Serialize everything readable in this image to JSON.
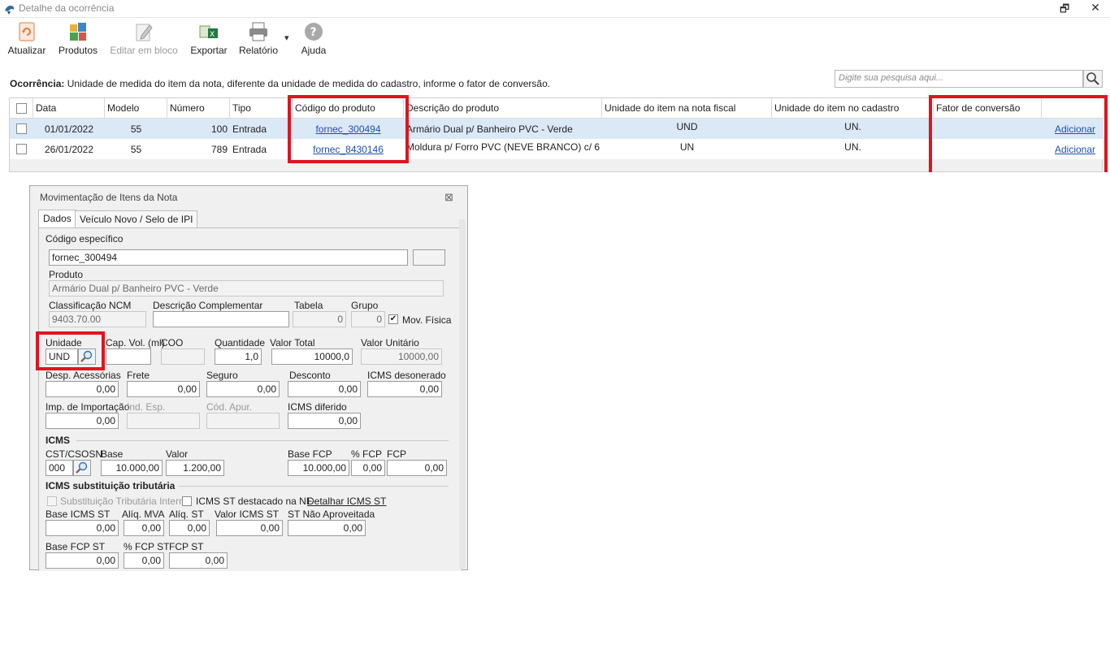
{
  "window": {
    "title": "Detalhe da ocorrência",
    "restore_glyph": "🗗",
    "close_glyph": "✕"
  },
  "toolbar": {
    "atualizar": "Atualizar",
    "produtos": "Produtos",
    "editar_em_bloco": "Editar em bloco",
    "exportar": "Exportar",
    "relatorio": "Relatório",
    "relatorio_arrow": "▾",
    "ajuda": "Ajuda"
  },
  "ocorrencia": {
    "label": "Ocorrência:",
    "text": "Unidade de medida do item da nota, diferente da unidade de medida do cadastro, informe o fator de conversão."
  },
  "search": {
    "placeholder": "Digite sua pesquisa aqui..."
  },
  "grid": {
    "columns": {
      "data": "Data",
      "modelo": "Modelo",
      "numero": "Número",
      "tipo": "Tipo",
      "codigo_produto": "Código do produto",
      "descricao_produto": "Descrição do produto",
      "unidade_nota": "Unidade do item na nota fiscal",
      "unidade_cadastro": "Unidade do item no cadastro",
      "fator_conversao": "Fator de conversão"
    },
    "rows": [
      {
        "data": "01/01/2022",
        "modelo": "55",
        "numero": "100",
        "tipo": "Entrada",
        "codigo_produto": "fornec_300494",
        "descricao_produto": "Armário Dual p/ Banheiro PVC - Verde",
        "unidade_nota": "UND",
        "unidade_cadastro": "UN.",
        "fator_conversao": "",
        "acao": "Adicionar"
      },
      {
        "data": "26/01/2022",
        "modelo": "55",
        "numero": "789",
        "tipo": "Entrada",
        "codigo_produto": "fornec_8430146",
        "descricao_produto": "Moldura p/ Forro PVC (NEVE BRANCO) c/ 6",
        "unidade_nota": "UN",
        "unidade_cadastro": "UN.",
        "fator_conversao": "",
        "acao": "Adicionar"
      }
    ]
  },
  "dialog": {
    "title": "Movimentação de Itens da Nota",
    "close_glyph": "⊠",
    "tabs": [
      "Dados",
      "Veículo Novo / Selo de IPI"
    ],
    "codigo_especifico_label": "Código específico",
    "codigo_especifico_value": "fornec_300494",
    "produto_label": "Produto",
    "produto_value": "Armário Dual p/ Banheiro PVC - Verde",
    "classificacao_ncm_label": "Classificação NCM",
    "classificacao_ncm_value": "9403.70.00",
    "descricao_complementar_label": "Descrição Complementar",
    "descricao_complementar_value": "",
    "tabela_label": "Tabela",
    "tabela_value": "0",
    "grupo_label": "Grupo",
    "grupo_value": "0",
    "mov_fisica_label": "Mov. Física",
    "mov_fisica_mark": "✔",
    "unidade_label": "Unidade",
    "unidade_value": "UND",
    "cap_vol_label": "Cap. Vol. (ml)",
    "cap_vol_value": "",
    "coo_label": "COO",
    "coo_value": "",
    "quantidade_label": "Quantidade",
    "quantidade_value": "1,0",
    "valor_total_label": "Valor Total",
    "valor_total_value": "10000,0",
    "valor_unitario_label": "Valor Unitário",
    "valor_unitario_value": "10000,00",
    "desp_acessorias_label": "Desp. Acessórias",
    "desp_acessorias_value": "0,00",
    "frete_label": "Frete",
    "frete_value": "0,00",
    "seguro_label": "Seguro",
    "seguro_value": "0,00",
    "desconto_label": "Desconto",
    "desconto_value": "0,00",
    "icms_desonerado_label": "ICMS desonerado",
    "icms_desonerado_value": "0,00",
    "imp_importacao_label": "Imp. de Importação",
    "imp_importacao_value": "0,00",
    "ind_esp_label": "Ind. Esp.",
    "cod_apur_label": "Cód. Apur.",
    "icms_diferido_label": "ICMS diferido",
    "icms_diferido_value": "0,00",
    "icms_section": "ICMS",
    "cst_csosn_label": "CST/CSOSN",
    "cst_csosn_value": "000",
    "base_label": "Base",
    "base_value": "10.000,00",
    "valor_label": "Valor",
    "valor_value": "1.200,00",
    "base_fcp_label": "Base FCP",
    "base_fcp_value": "10.000,00",
    "pct_fcp_label": "% FCP",
    "pct_fcp_value": "0,00",
    "fcp_label": "FCP",
    "fcp_value": "0,00",
    "icms_st_section": "ICMS substituição tributária",
    "st_interna_label": "Substituição Tributária Interna",
    "icms_st_destacado_label": "ICMS ST destacado na NF",
    "detalhar_icms_st": "Detalhar ICMS ST",
    "base_icms_st_label": "Base ICMS ST",
    "base_icms_st_value": "0,00",
    "aliq_mva_label": "Alíq. MVA",
    "aliq_mva_value": "0,00",
    "aliq_st_label": "Alíq. ST",
    "aliq_st_value": "0,00",
    "valor_icms_st_label": "Valor ICMS ST",
    "valor_icms_st_value": "0,00",
    "st_nao_aproveitada_label": "ST Não Aproveitada",
    "st_nao_aproveitada_value": "0,00",
    "base_fcp_st_label": "Base FCP ST",
    "base_fcp_st_value": "0,00",
    "pct_fcp_st_label": "% FCP ST",
    "pct_fcp_st_value": "0,00",
    "fcp_st_label": "FCP ST",
    "fcp_st_value": "0,00"
  },
  "colors": {
    "highlight_red": "#e0141e",
    "selected_row": "#dbe8f6",
    "link_blue": "#1f4fb8"
  }
}
